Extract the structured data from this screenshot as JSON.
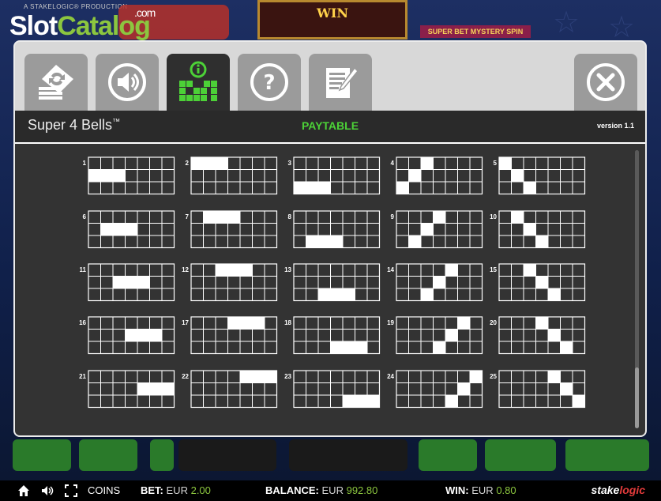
{
  "watermark": {
    "name_a": "Slot",
    "name_b": "Catalog",
    "suffix": ".com"
  },
  "background": {
    "producer": "A STAKELOGIC® PRODUCTION",
    "win_banner": "WIN",
    "slogan": "SUPER BET MYSTERY SPIN"
  },
  "tabs": [
    {
      "name": "settings",
      "icon": "settings-icon"
    },
    {
      "name": "sound",
      "icon": "speaker-icon"
    },
    {
      "name": "paytable",
      "icon": "paytable-icon",
      "active": true
    },
    {
      "name": "help",
      "icon": "help-icon"
    },
    {
      "name": "rules",
      "icon": "rules-document-icon"
    }
  ],
  "close_icon": "close-icon",
  "header": {
    "game_title": "Super 4 Bells",
    "trademark": "™",
    "section": "PAYTABLE",
    "version": "version 1.1"
  },
  "paylines": [
    {
      "label": "1",
      "cells": [
        [
          1,
          0
        ],
        [
          1,
          1
        ],
        [
          1,
          2
        ]
      ]
    },
    {
      "label": "2",
      "cells": [
        [
          0,
          0
        ],
        [
          0,
          1
        ],
        [
          0,
          2
        ]
      ]
    },
    {
      "label": "3",
      "cells": [
        [
          2,
          0
        ],
        [
          2,
          1
        ],
        [
          2,
          2
        ]
      ]
    },
    {
      "label": "4",
      "cells": [
        [
          2,
          0
        ],
        [
          1,
          1
        ],
        [
          0,
          2
        ]
      ]
    },
    {
      "label": "5",
      "cells": [
        [
          0,
          0
        ],
        [
          1,
          1
        ],
        [
          2,
          2
        ]
      ]
    },
    {
      "label": "6",
      "cells": [
        [
          1,
          1
        ],
        [
          1,
          2
        ],
        [
          1,
          3
        ]
      ]
    },
    {
      "label": "7",
      "cells": [
        [
          0,
          1
        ],
        [
          0,
          2
        ],
        [
          0,
          3
        ]
      ]
    },
    {
      "label": "8",
      "cells": [
        [
          2,
          1
        ],
        [
          2,
          2
        ],
        [
          2,
          3
        ]
      ]
    },
    {
      "label": "9",
      "cells": [
        [
          2,
          1
        ],
        [
          1,
          2
        ],
        [
          0,
          3
        ]
      ]
    },
    {
      "label": "10",
      "cells": [
        [
          0,
          1
        ],
        [
          1,
          2
        ],
        [
          2,
          3
        ]
      ]
    },
    {
      "label": "11",
      "cells": [
        [
          1,
          2
        ],
        [
          1,
          3
        ],
        [
          1,
          4
        ]
      ]
    },
    {
      "label": "12",
      "cells": [
        [
          0,
          2
        ],
        [
          0,
          3
        ],
        [
          0,
          4
        ]
      ]
    },
    {
      "label": "13",
      "cells": [
        [
          2,
          2
        ],
        [
          2,
          3
        ],
        [
          2,
          4
        ]
      ]
    },
    {
      "label": "14",
      "cells": [
        [
          2,
          2
        ],
        [
          1,
          3
        ],
        [
          0,
          4
        ]
      ]
    },
    {
      "label": "15",
      "cells": [
        [
          0,
          2
        ],
        [
          1,
          3
        ],
        [
          2,
          4
        ]
      ]
    },
    {
      "label": "16",
      "cells": [
        [
          1,
          3
        ],
        [
          1,
          4
        ],
        [
          1,
          5
        ]
      ]
    },
    {
      "label": "17",
      "cells": [
        [
          0,
          3
        ],
        [
          0,
          4
        ],
        [
          0,
          5
        ]
      ]
    },
    {
      "label": "18",
      "cells": [
        [
          2,
          3
        ],
        [
          2,
          4
        ],
        [
          2,
          5
        ]
      ]
    },
    {
      "label": "19",
      "cells": [
        [
          2,
          3
        ],
        [
          1,
          4
        ],
        [
          0,
          5
        ]
      ]
    },
    {
      "label": "20",
      "cells": [
        [
          0,
          3
        ],
        [
          1,
          4
        ],
        [
          2,
          5
        ]
      ]
    },
    {
      "label": "21",
      "cells": [
        [
          1,
          4
        ],
        [
          1,
          5
        ],
        [
          1,
          6
        ]
      ]
    },
    {
      "label": "22",
      "cells": [
        [
          0,
          4
        ],
        [
          0,
          5
        ],
        [
          0,
          6
        ]
      ]
    },
    {
      "label": "23",
      "cells": [
        [
          2,
          4
        ],
        [
          2,
          5
        ],
        [
          2,
          6
        ]
      ]
    },
    {
      "label": "24",
      "cells": [
        [
          2,
          4
        ],
        [
          1,
          5
        ],
        [
          0,
          6
        ]
      ]
    },
    {
      "label": "25",
      "cells": [
        [
          0,
          4
        ],
        [
          1,
          5
        ],
        [
          2,
          6
        ]
      ]
    }
  ],
  "grid": {
    "rows": 3,
    "cols": 7
  },
  "status_bar": {
    "coins_label": "COINS",
    "bet_label": "BET:",
    "bet_currency": "EUR",
    "bet_value": "2.00",
    "balance_label": "BALANCE:",
    "balance_currency": "EUR",
    "balance_value": "992.80",
    "win_label": "WIN:",
    "win_currency": "EUR",
    "win_value": "0.80",
    "brand_a": "stake",
    "brand_b": "logic"
  },
  "colors": {
    "accent": "#4cd137",
    "panel": "#333333",
    "tab": "#9b9b9b",
    "tab_active": "#2f2f2f"
  }
}
